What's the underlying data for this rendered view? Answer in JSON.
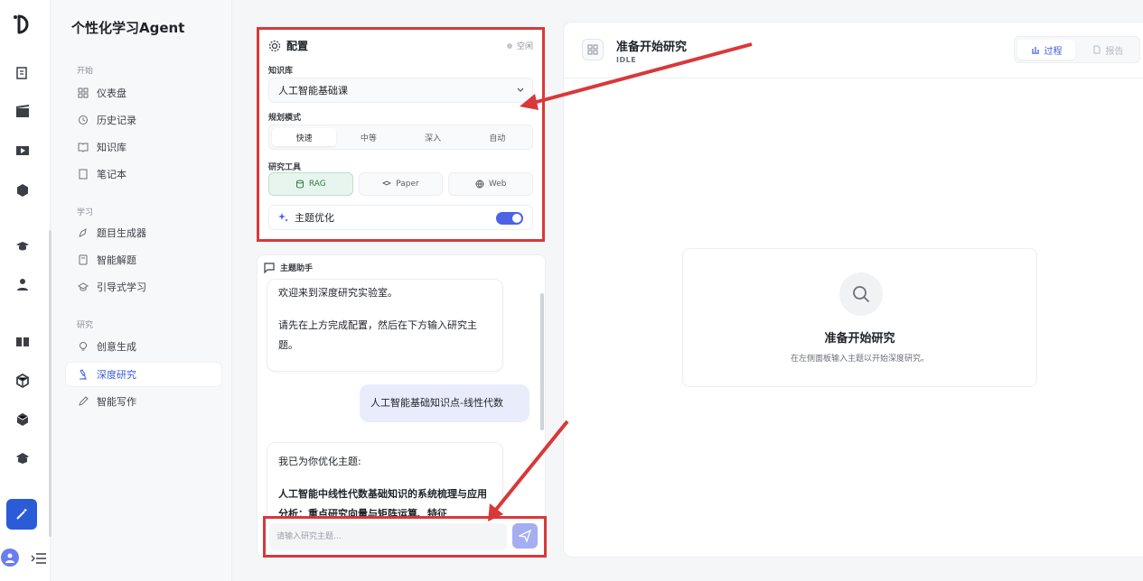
{
  "app": {
    "title": "个性化学习Agent"
  },
  "sidebar": {
    "sections": [
      {
        "label": "开始",
        "items": [
          "仪表盘",
          "历史记录",
          "知识库",
          "笔记本"
        ]
      },
      {
        "label": "学习",
        "items": [
          "题目生成器",
          "智能解题",
          "引导式学习"
        ]
      },
      {
        "label": "研究",
        "items": [
          "创意生成",
          "深度研究",
          "智能写作"
        ]
      }
    ],
    "active_item": "深度研究"
  },
  "config": {
    "title": "配置",
    "status": "空闲",
    "kb_label": "知识库",
    "kb_value": "人工智能基础课",
    "mode_label": "规划模式",
    "modes": [
      "快速",
      "中等",
      "深入",
      "自动"
    ],
    "active_mode": "快速",
    "tools_label": "研究工具",
    "tools": [
      "RAG",
      "Paper",
      "Web"
    ],
    "active_tool": "RAG",
    "topic_opt_label": "主题优化",
    "topic_opt_on": true
  },
  "chat": {
    "title": "主题助手",
    "messages": [
      {
        "role": "assistant",
        "lines": [
          "欢迎来到深度研究实验室。",
          "请先在上方完成配置，然后在下方输入研究主题。"
        ]
      },
      {
        "role": "user",
        "text": "人工智能基础知识点-线性代数"
      },
      {
        "role": "assistant",
        "intro": "我已为你优化主题:",
        "bold": "人工智能中线性代数基础知识的系统梳理与应用分析：重点研究向量与矩阵运算、特征"
      }
    ],
    "input_placeholder": "请输入研究主题..."
  },
  "main": {
    "title": "准备开始研究",
    "subtitle": "IDLE",
    "tabs": [
      "过程",
      "报告"
    ],
    "active_tab": "过程",
    "empty_title": "准备开始研究",
    "empty_subtitle": "在左侧面板输入主题以开始深度研究。"
  },
  "colors": {
    "accent": "#3b5bdb",
    "annotation": "#d9383a",
    "active_tool_bg": "#e8f5ee"
  }
}
